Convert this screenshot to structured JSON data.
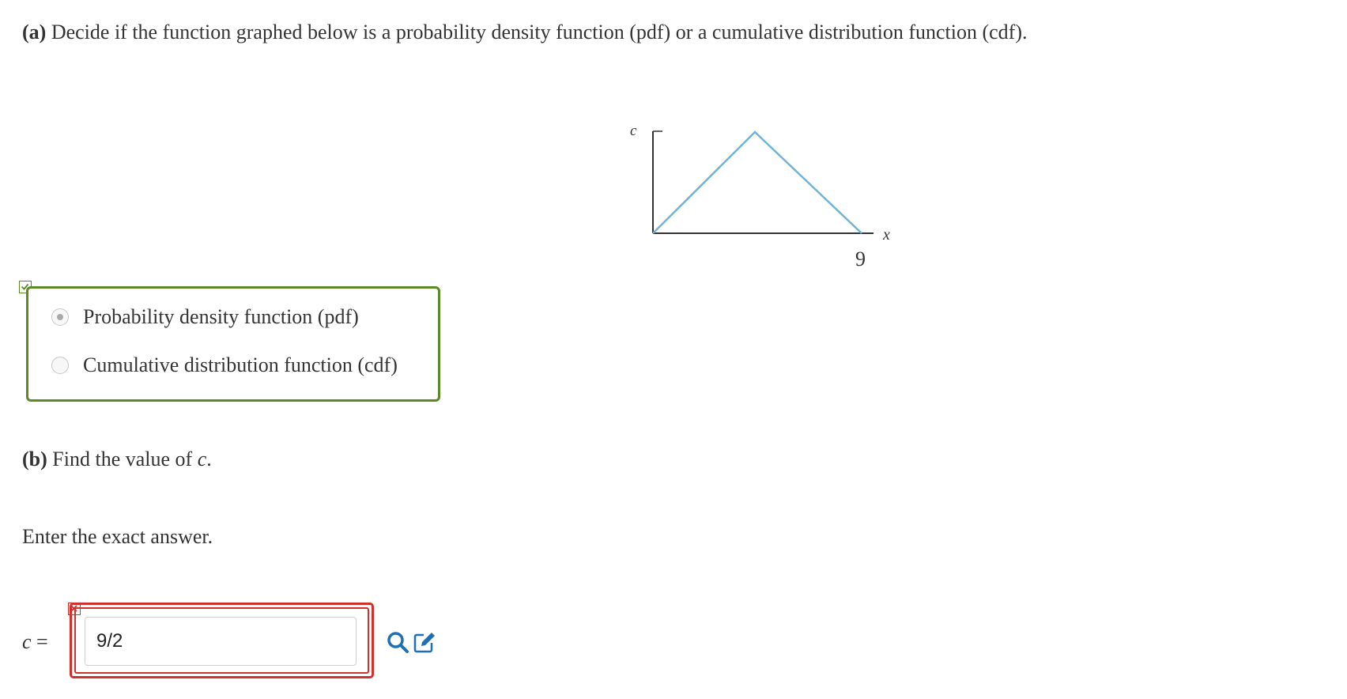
{
  "part_a": {
    "prefix": "(a)",
    "text": " Decide if the function graphed below is a probability density function (pdf) or a cumulative distribution function (cdf)."
  },
  "graph": {
    "y_label": "c",
    "x_label": "x",
    "x_tick": "9"
  },
  "options": [
    {
      "label": "Probability density function (pdf)",
      "selected": true
    },
    {
      "label": "Cumulative distribution function (cdf)",
      "selected": false
    }
  ],
  "part_b": {
    "prefix": "(b)",
    "text": " Find the value of ",
    "var": "c",
    "end": "."
  },
  "instruction": "Enter the exact answer.",
  "answer": {
    "label_var": "c",
    "label_eq": " =",
    "value": "9/2"
  },
  "colors": {
    "correct": "#5a8a26",
    "incorrect": "#d0312d",
    "graph_line": "#6fb3d8",
    "tool_icon": "#1f6fb4"
  }
}
